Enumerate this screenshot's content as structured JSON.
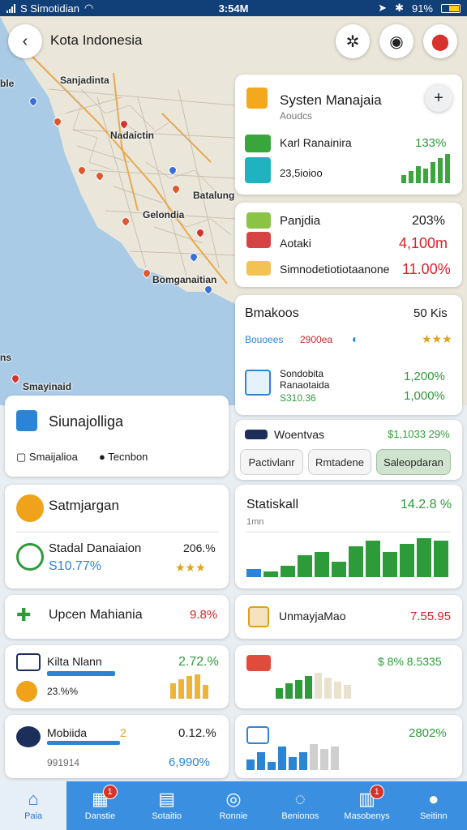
{
  "status_bar": {
    "carrier": "S Simotidian",
    "time": "3:54M",
    "battery": "91%"
  },
  "header": {
    "title": "Kota Indonesia",
    "back_icon": "back-arrow-icon"
  },
  "map_labels": [
    "Sanjadinta",
    "Nadaictin",
    "Gelondia",
    "Batalung",
    "Bomganaitian",
    "Smayinaid",
    "ble",
    "ns"
  ],
  "system_card": {
    "title": "Systen Manajaia",
    "subtitle": "Aoudcs",
    "row_label": "Karl Ranainira",
    "row_value": "133%",
    "sub_value": "23,5ioioo",
    "trend": [
      4,
      6,
      8,
      7,
      10,
      12,
      14
    ]
  },
  "project_card": {
    "rows": [
      {
        "label": "Panjdia",
        "value": "203%"
      },
      {
        "label": "Aotaki",
        "value": "4,100m"
      },
      {
        "label": "Simnodetiotiotaanone",
        "value": "11.00%"
      }
    ]
  },
  "stats_card": {
    "title": "Bmakoos",
    "value": "50 Kis",
    "metrics": [
      "Bouoees",
      "2900ea"
    ],
    "row_title": "Sondobita",
    "row_sub": "Ranaotaida",
    "row_footer": "S310.36",
    "pct1": "1,200%",
    "pct2": "1,000%"
  },
  "sinuma_card": {
    "title": "Siunajolliga",
    "tag1": "Smaijalioa",
    "tag2": "Tecnbon"
  },
  "woentvas_card": {
    "title": "Woentvas",
    "value": "$1,1033 29%",
    "tabs": [
      "Pactivlanr",
      "Rmtadene",
      "Saleopdaran"
    ]
  },
  "satum_card": {
    "title": "Satmjargan",
    "row_label": "Stadal Danaiaion",
    "row_value": "S10.77%",
    "pct": "206.%"
  },
  "statistik_card": {
    "title": "Statiskall",
    "subtitle": "1mn",
    "value": "14.2.8 %",
    "bars": [
      6,
      4,
      8,
      16,
      18,
      11,
      22,
      26,
      18,
      24,
      28,
      26
    ]
  },
  "upcom_card": {
    "title": "Upcen Mahiania",
    "value": "9.8%"
  },
  "unmay_card": {
    "title": "UnmayjaMao",
    "value": "7.55.95"
  },
  "kota_card": {
    "title": "Kilta Nlann",
    "pct": "2.72.%",
    "sub": "23.%%",
    "bars": [
      18,
      22,
      26,
      28,
      16
    ]
  },
  "mid_right_card": {
    "value": "$ 8% 8.5335",
    "bars": [
      12,
      18,
      22,
      26,
      30,
      24,
      20,
      16
    ]
  },
  "mobile_card": {
    "title": "Mobiida",
    "tick": "2",
    "value": "0.12.%",
    "sub": "991914",
    "pct": "6,990%"
  },
  "last_right_card": {
    "value": "2802%",
    "bars": [
      8,
      14,
      6,
      18,
      10,
      14,
      20,
      16,
      18
    ]
  },
  "nav": [
    {
      "label": "Paia",
      "icon": "home-icon",
      "glyph": "⌂",
      "active": true
    },
    {
      "label": "Danstie",
      "icon": "grid-icon",
      "glyph": "▦",
      "badge": "1"
    },
    {
      "label": "Sotaitio",
      "icon": "document-icon",
      "glyph": "▤"
    },
    {
      "label": "Ronnie",
      "icon": "heart-icon",
      "glyph": "◎"
    },
    {
      "label": "Benionos",
      "icon": "chat-icon",
      "glyph": "◌"
    },
    {
      "label": "Masobenys",
      "icon": "chart-icon",
      "glyph": "▥",
      "badge": "1"
    },
    {
      "label": "Seitinn",
      "icon": "profile-icon",
      "glyph": "●"
    }
  ],
  "colors": {
    "accent": "#3b8fe0",
    "status_bar": "#113f78",
    "green": "#2e9b3a",
    "red": "#d2262a"
  }
}
